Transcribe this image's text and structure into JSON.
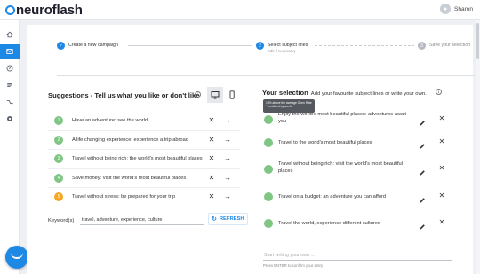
{
  "app": {
    "logo_text": "neuroflash",
    "user_name": "Sharon"
  },
  "sidebar": {
    "items": [
      {
        "icon": "home-icon"
      },
      {
        "icon": "mail-icon",
        "active": true
      },
      {
        "icon": "compass-icon"
      },
      {
        "icon": "list-icon"
      },
      {
        "icon": "flow-icon"
      },
      {
        "icon": "circle-icon"
      }
    ]
  },
  "stepper": {
    "steps": [
      {
        "number": "✓",
        "label": "Create a new campaign",
        "sublabel": "",
        "state": "done"
      },
      {
        "number": "2",
        "label": "Select subject lines",
        "sublabel": "Edit if necessary",
        "state": "current"
      },
      {
        "number": "3",
        "label": "Save your selection",
        "sublabel": "",
        "state": "todo"
      }
    ]
  },
  "suggestions": {
    "title": "Suggestions - Tell us what you like or don't like",
    "items": [
      {
        "number": "1",
        "text": "Have an adventure: see the world",
        "color": "#7fc583"
      },
      {
        "number": "2",
        "text": "A life changing experience: experience a trip abroad",
        "color": "#7fc583"
      },
      {
        "number": "3",
        "text": "Travel without being rich: the world's most beautiful places",
        "color": "#7fc583"
      },
      {
        "number": "4",
        "text": "Save money: visit the world's most beautiful places",
        "color": "#7fc583"
      },
      {
        "number": "5",
        "text": "Travel without stress: be prepared for your trip",
        "color": "#f5a623"
      }
    ],
    "keywords_label": "Keyword(s)",
    "keywords_value": "travel, adventure, experience, culture",
    "refresh_label": "REFRESH"
  },
  "selection": {
    "title": "Your selection",
    "subtitle": "Add your favourite subject lines or write your own.",
    "tooltip_line1": "13% above the average Open Rate",
    "tooltip_line2": "* predicted by our AI",
    "items": [
      {
        "text": "Enjoy the world's most beautiful places: adventures await you"
      },
      {
        "text": "Travel to the world's most beautiful places"
      },
      {
        "text": "Travel without being rich: visit the world's most beautiful places"
      },
      {
        "text": "Travel on a budget: an adventure you can afford"
      },
      {
        "text": "Travel the world, experience different cultures"
      }
    ],
    "write_placeholder": "Start writing your own ...",
    "write_hint": "Press ENTER to confirm your entry"
  },
  "colors": {
    "accent": "#1e88e5",
    "positive": "#7fc583",
    "warning": "#f5a623"
  }
}
